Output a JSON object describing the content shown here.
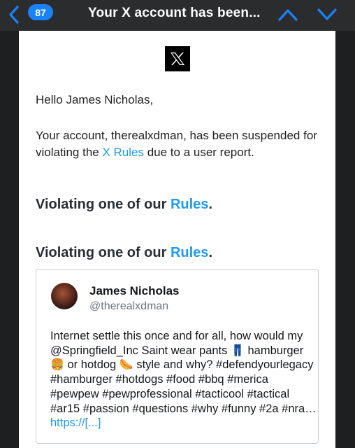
{
  "nav": {
    "badge_count": "87",
    "title": "Your X account has been...",
    "back_icon": "chevron-left-icon",
    "prev_icon": "chevron-up-icon",
    "next_icon": "chevron-down-icon",
    "accent_color": "#1a82f7"
  },
  "email": {
    "logo": "X",
    "greeting": "Hello James Nicholas,",
    "para_before": "Your account, therealxdman, has been suspended for violating the ",
    "para_link": "X Rules",
    "para_after": " due to a user report.",
    "heading_prefix": "Violating one of our ",
    "heading_link": "Rules",
    "heading_suffix": ".",
    "link_color": "#1d9bf0"
  },
  "post": {
    "author_name": "James Nicholas",
    "author_handle": "@therealxdman",
    "text_1": "Internet settle this once and for all, how would my @Springfield_Inc Saint wear pants ",
    "emoji_pants": "👖",
    "text_2": " hamburger ",
    "emoji_burger": "🍔",
    "text_3": " or hotdog ",
    "emoji_hotdog": "🌭",
    "text_4": " style and why? #defendyourlegacy #hamburger #hotdogs #food #bbq #merica #pewpew #pewprofessional #tacticool #tactical #ar15 #passion #questions #why #funny #2a #nra… ",
    "link": "https://[...]"
  }
}
